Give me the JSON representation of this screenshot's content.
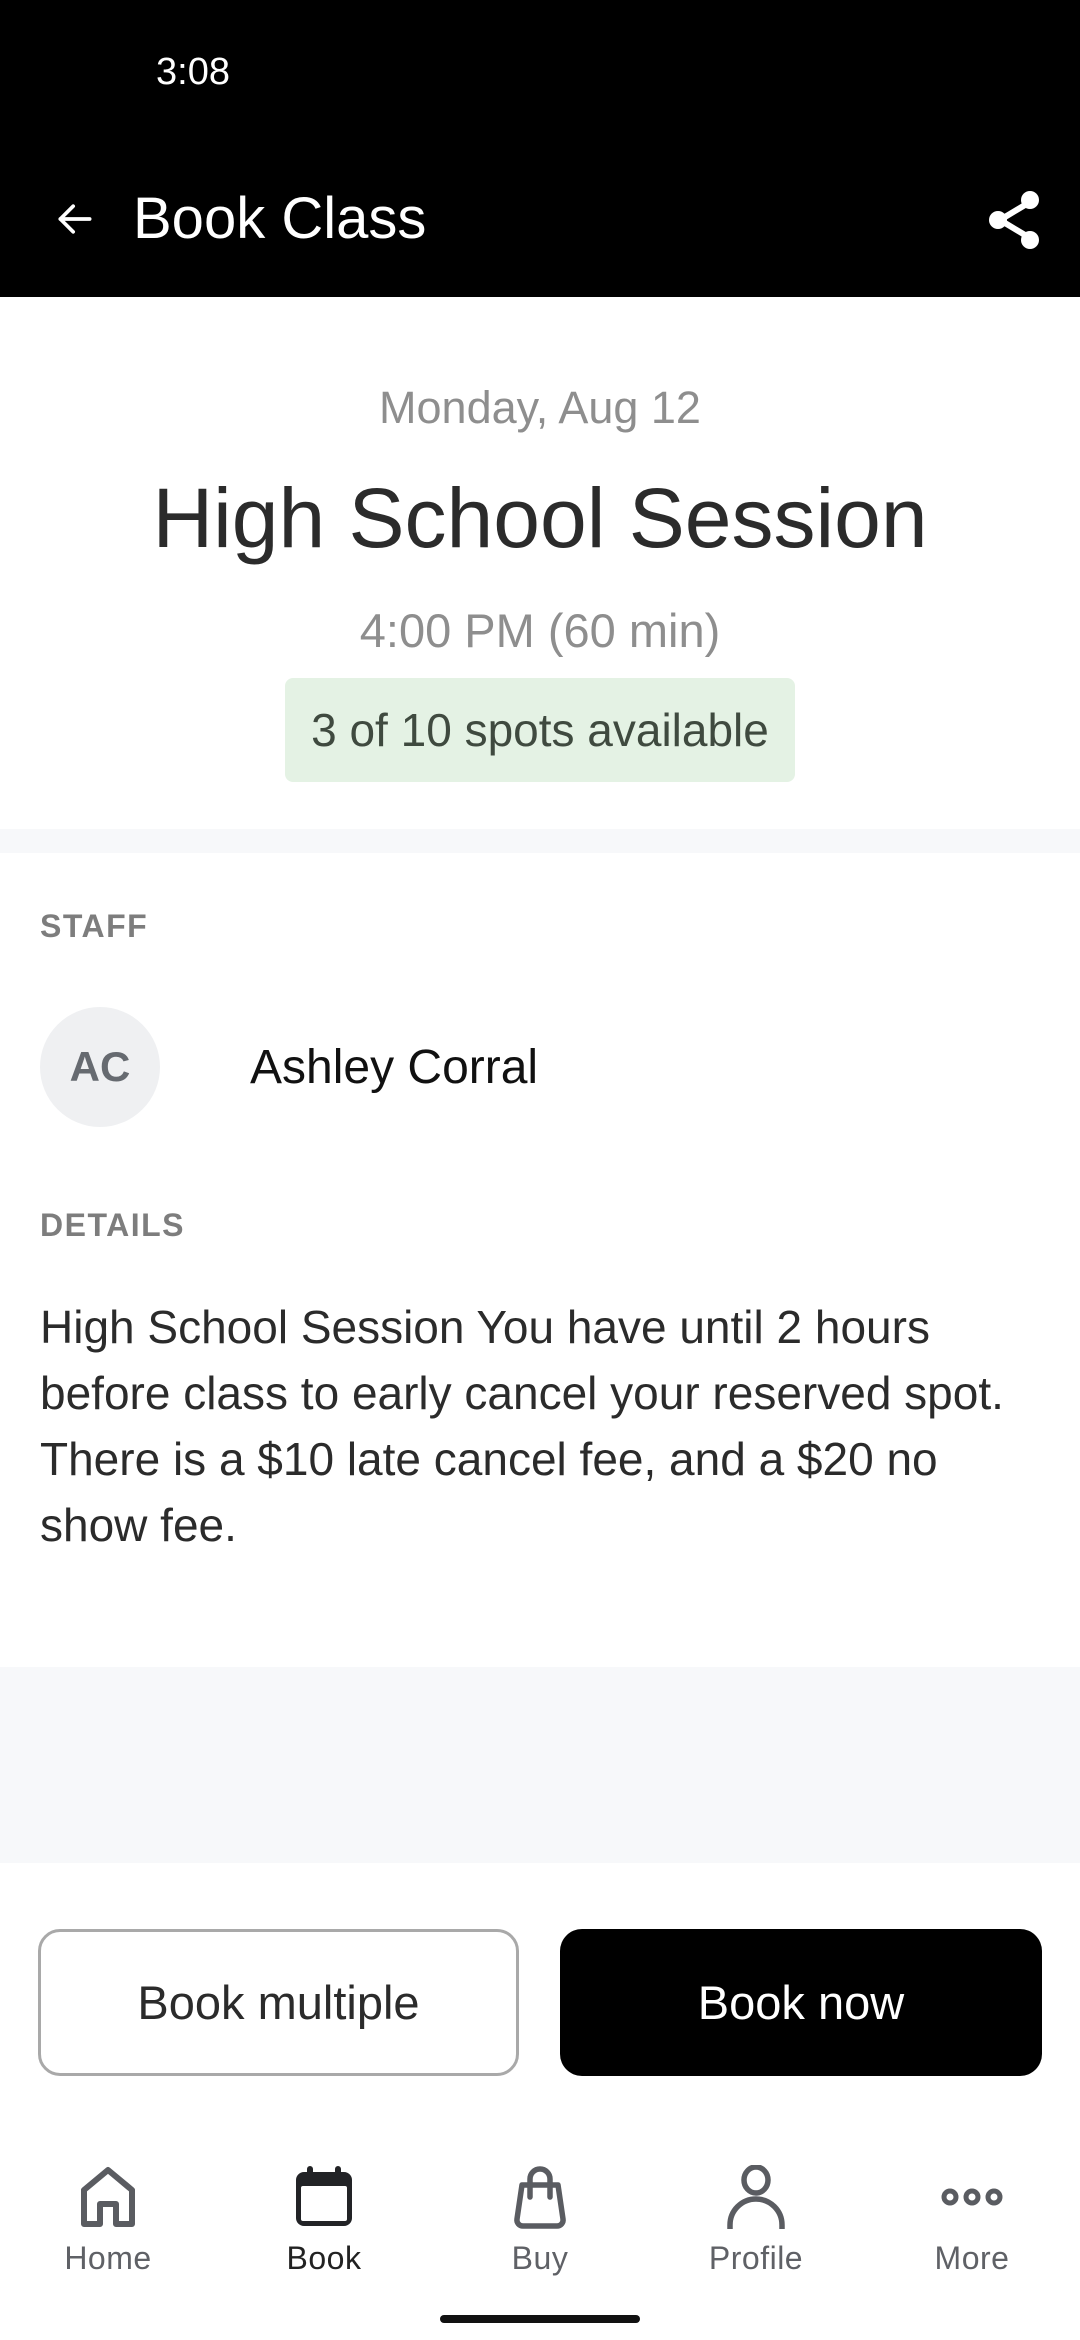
{
  "status_bar": {
    "time": "3:08"
  },
  "app_bar": {
    "title": "Book Class",
    "back_icon": "arrow-left-icon",
    "share_icon": "share-icon"
  },
  "class": {
    "date": "Monday, Aug 12",
    "title": "High School Session",
    "time": "4:00 PM (60 min)",
    "spots": "3 of 10 spots available",
    "spots_available": 3,
    "spots_total": 10,
    "badge_color": "#e4f2e4"
  },
  "staff": {
    "section_label": "STAFF",
    "initials": "AC",
    "name": "Ashley Corral"
  },
  "details": {
    "section_label": "DETAILS",
    "text": "High School Session You have until 2 hours before class to early cancel your reserved spot. There is a $10 late cancel fee, and a $20 no show fee."
  },
  "actions": {
    "book_multiple": "Book multiple",
    "book_now": "Book now"
  },
  "bottom_nav": {
    "active": "Book",
    "items": [
      {
        "label": "Home",
        "icon": "home-icon"
      },
      {
        "label": "Book",
        "icon": "calendar-icon"
      },
      {
        "label": "Buy",
        "icon": "shopping-bag-icon"
      },
      {
        "label": "Profile",
        "icon": "person-icon"
      },
      {
        "label": "More",
        "icon": "more-horizontal-icon"
      }
    ]
  }
}
